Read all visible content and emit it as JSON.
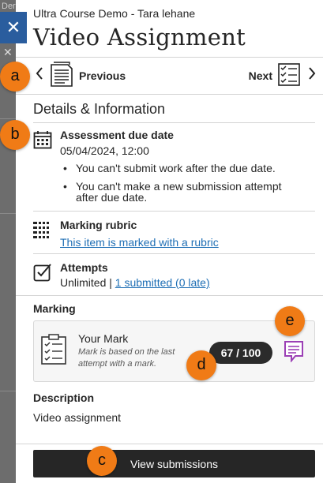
{
  "backdrop": {
    "text": "Der"
  },
  "window": {
    "course_name": "Ultra Course Demo - Tara lehane",
    "title": "Video Assignment"
  },
  "nav": {
    "prev_label": "Previous",
    "next_label": "Next"
  },
  "details": {
    "section_title": "Details & Information",
    "due": {
      "title": "Assessment due date",
      "value": "05/04/2024, 12:00",
      "bullets": [
        "You can't submit work after the due date.",
        "You can't make a new submission attempt after due date."
      ]
    },
    "rubric": {
      "title": "Marking rubric",
      "link": "This item is marked with a rubric"
    },
    "attempts": {
      "title": "Attempts",
      "value": "Unlimited",
      "separator": "|",
      "link": "1 submitted (0 late)"
    }
  },
  "marking": {
    "label": "Marking",
    "your_mark_title": "Your Mark",
    "note": "Mark is based on the last attempt with a mark.",
    "score": "67 / 100"
  },
  "description": {
    "label": "Description",
    "text": "Video assignment"
  },
  "footer": {
    "button_label": "View submissions"
  },
  "callouts": [
    "a",
    "b",
    "c",
    "d",
    "e"
  ],
  "colors": {
    "callout": "#f07b16",
    "close_button": "#2a5d9e",
    "feedback_icon": "#9b3fb5",
    "link": "#1f6fb5"
  },
  "icons": [
    "close-icon",
    "chevron-left-icon",
    "document-icon",
    "checklist-icon",
    "chevron-right-icon",
    "calendar-icon",
    "rubric-grid-icon",
    "checkbox-icon",
    "feedback-icon"
  ]
}
